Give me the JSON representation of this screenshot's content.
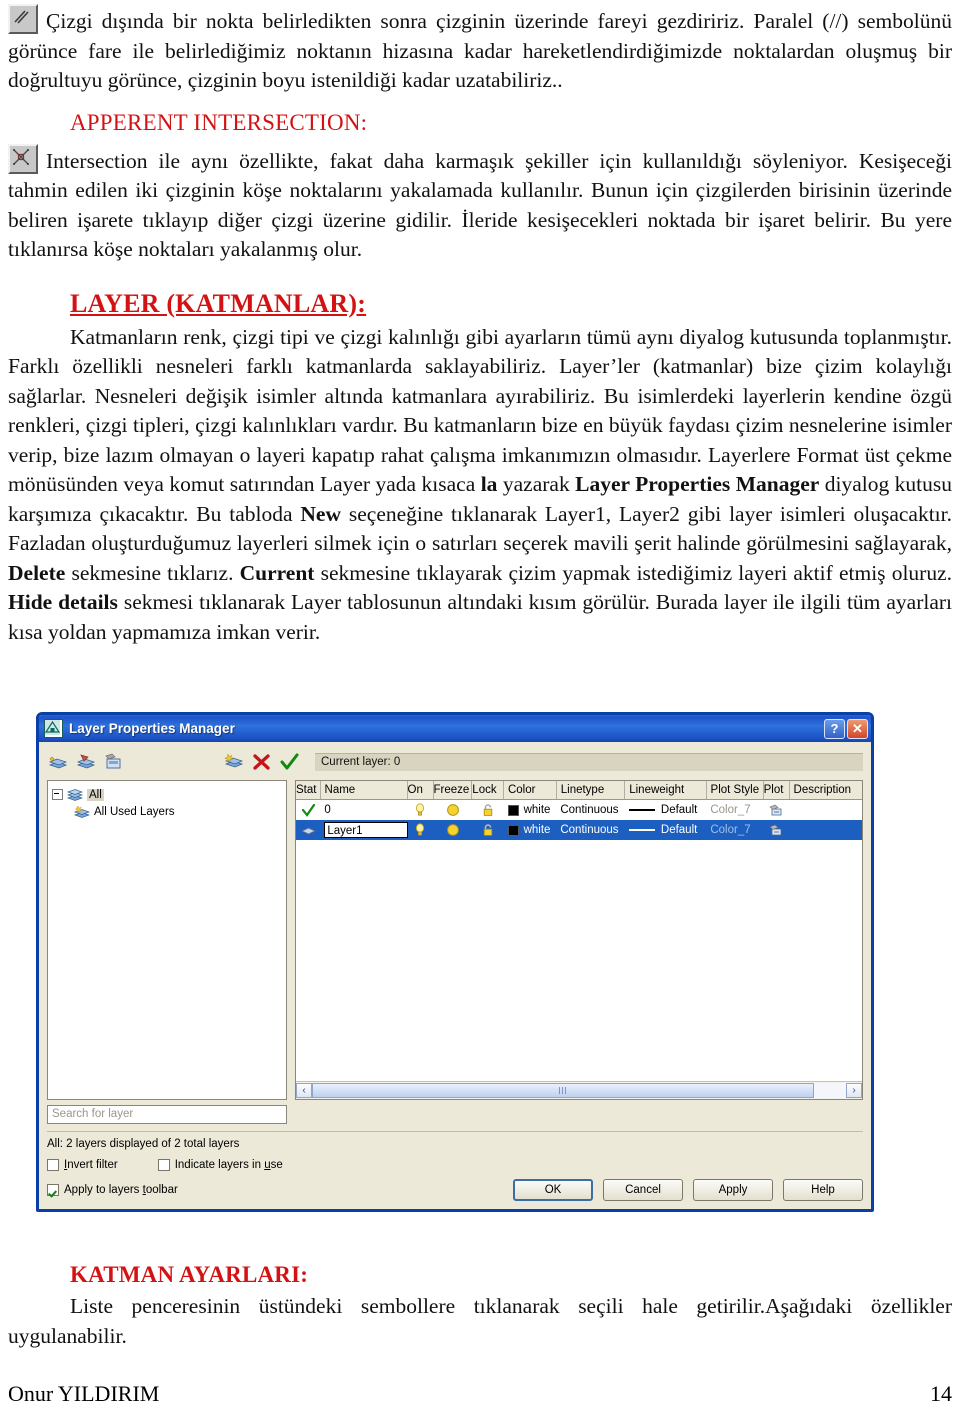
{
  "document": {
    "para1": "Çizgi dışında bir nokta belirledikten sonra çizginin üzerinde fareyi gezdiririz. Paralel (//) sembolünü görünce fare ile belirlediğimiz noktanın hizasına kadar hareketlendirdiğimizde noktalardan oluşmuş bir doğrultuyu görünce, çizginin boyu istenildiği kadar uzatabiliriz..",
    "heading_apparent": "APPERENT INTERSECTION:",
    "para2": "Intersection ile aynı özellikte, fakat daha karmaşık şekiller için kullanıldığı söyleniyor. Kesişeceği tahmin edilen iki çizginin köşe noktalarını yakalamada kullanılır. Bunun için çizgilerden birisinin üzerinde beliren işarete tıklayıp diğer çizgi üzerine gidilir. İleride kesişecekleri noktada bir işaret belirir. Bu yere tıklanırsa köşe noktaları yakalanmış olur.",
    "heading_layer": "LAYER (KATMANLAR):",
    "para3_a": "Katmanların renk, çizgi tipi ve çizgi kalınlığı gibi ayarların tümü aynı diyalog kutusunda toplanmıştır. Farklı özellikli nesneleri farklı katmanlarda saklayabiliriz. Layer’ler (katmanlar) bize çizim kolaylığı sağlarlar. Nesneleri değişik isimler altında katmanlara ayırabiliriz. Bu isimlerdeki layerlerin kendine özgü renkleri, çizgi tipleri, çizgi kalınlıkları vardır. Bu katmanların bize en büyük faydası çizim nesnelerine isimler verip, bize lazım olmayan o layeri kapatıp rahat çalışma imkanımızın olmasıdır. Layerlere Format üst çekme mönüsünden veya komut satırından Layer yada kısaca ",
    "bold_la": "la",
    "para3_b": " yazarak ",
    "bold_lpm": "Layer Properties Manager",
    "para3_c": " diyalog kutusu karşımıza çıkacaktır. Bu tabloda ",
    "bold_new": "New",
    "para3_d": " seçeneğine tıklanarak Layer1, Layer2 gibi layer isimleri oluşacaktır. Fazladan oluşturduğumuz layerleri silmek için o satırları seçerek mavili şerit halinde görülmesini sağlayarak, ",
    "bold_delete": "Delete",
    "para3_e": " sekmesine tıklarız. ",
    "bold_current": "Current",
    "para3_f": " sekmesine tıklayarak çizim yapmak istediğimiz layeri aktif etmiş oluruz. ",
    "bold_hide": "Hide details",
    "para3_g": " sekmesi tıklanarak Layer tablosunun altındaki kısım görülür. Burada layer ile ilgili tüm ayarları kısa yoldan yapmamıza imkan verir.",
    "heading_katman": "KATMAN AYARLARI:",
    "para4": "Liste penceresinin üstündeki sembollere tıklanarak seçili hale getirilir.Aşağıdaki özellikler uygulanabilir."
  },
  "footer": {
    "author": "Onur YILDIRIM",
    "page": "14"
  },
  "dialog": {
    "title": "Layer Properties Manager",
    "help_button": "?",
    "close_button": "✕",
    "current_layer": "Current layer: 0",
    "tree": {
      "root": "All",
      "child": "All Used Layers"
    },
    "columns": [
      "Stat",
      "Name",
      "On",
      "Freeze",
      "Lock",
      "Color",
      "Linetype",
      "Lineweight",
      "Plot Style",
      "Plot",
      "Description"
    ],
    "rows": [
      {
        "stat": "✓",
        "name": "0",
        "name_editing": false,
        "color": "white",
        "linetype": "Continuous",
        "lineweight": "Default",
        "plotstyle": "Color_7",
        "description": ""
      },
      {
        "stat": "◆",
        "name": "Layer1",
        "name_editing": true,
        "color": "white",
        "linetype": "Continuous",
        "lineweight": "Default",
        "plotstyle": "Color_7",
        "description": ""
      }
    ],
    "search_placeholder": "Search for layer",
    "status": "All: 2 layers displayed of 2 total layers",
    "checkboxes": [
      {
        "label": "Invert filter",
        "checked": false
      },
      {
        "label": "Indicate layers in use",
        "checked": false
      },
      {
        "label": "Apply to layers toolbar",
        "checked": true
      }
    ],
    "buttons": [
      "OK",
      "Cancel",
      "Apply",
      "Help"
    ],
    "colors": {
      "titlebar_blue": "#1e54c8",
      "selection_blue": "#1d5fc0",
      "dialog_face": "#ece9d8",
      "heading_red": "#d31313"
    }
  }
}
